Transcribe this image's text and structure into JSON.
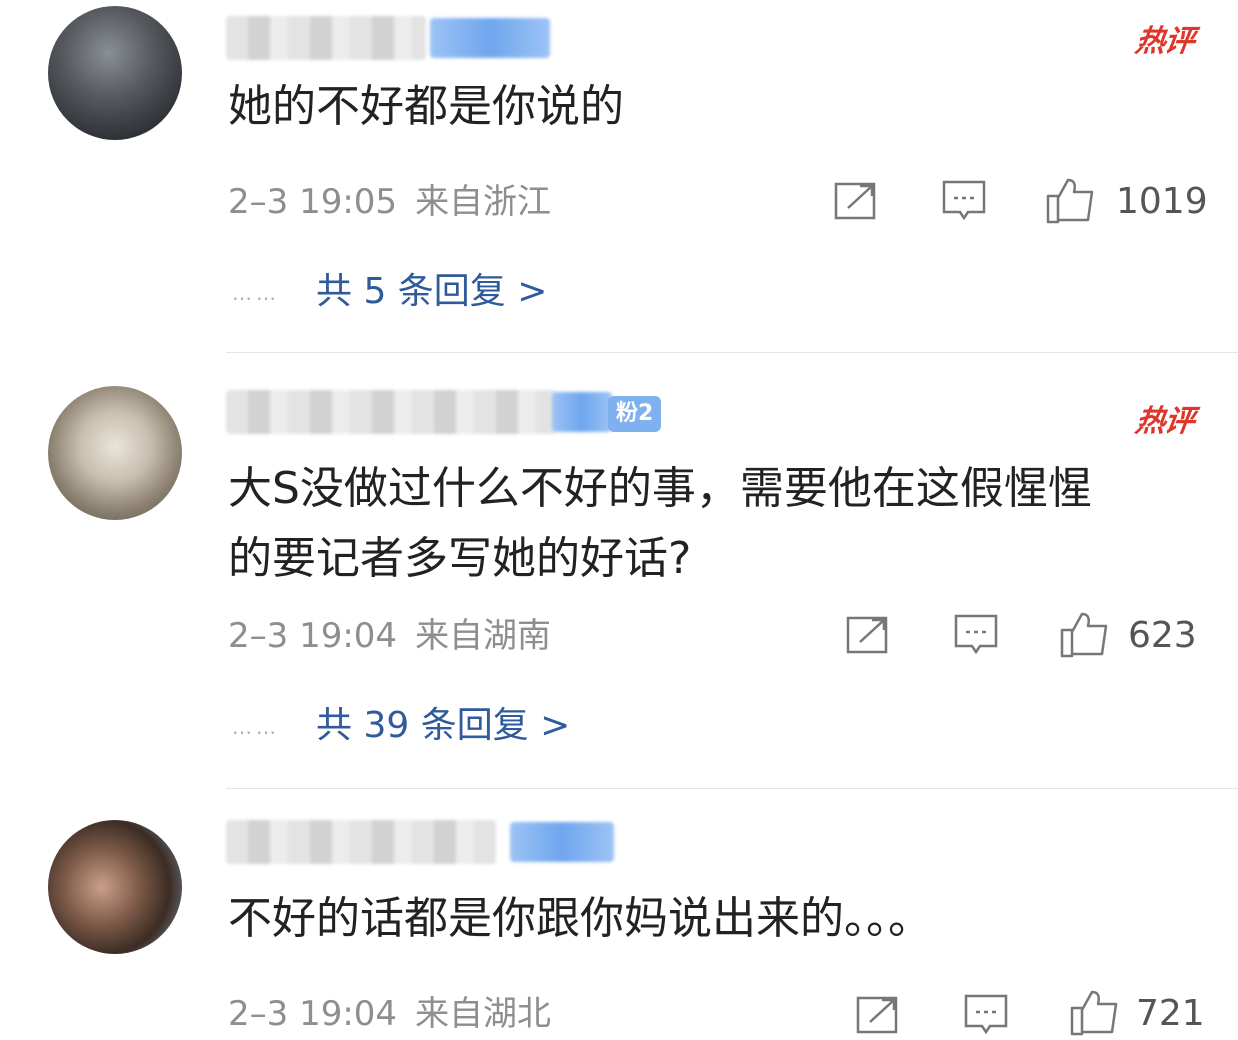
{
  "colors": {
    "accent_link": "#2f5a9c",
    "hot_red": "#e0352b",
    "meta_gray": "#8e8e8e"
  },
  "comments": [
    {
      "hot_label": "热评",
      "text": "她的不好都是你说的",
      "time": "2–3 19:05",
      "location": "来自浙江",
      "likes": "1019",
      "replies": "共 5 条回复 >",
      "dots": "……"
    },
    {
      "hot_label": "热评",
      "fan_badge": "粉2",
      "text": "大S没做过什么不好的事，需要他在这假惺惺\n的要记者多写她的好话?",
      "time": "2–3 19:04",
      "location": "来自湖南",
      "likes": "623",
      "replies": "共 39 条回复 >",
      "dots": "……"
    },
    {
      "text": "不好的话都是你跟你妈说出来的。。。",
      "time": "2–3 19:04",
      "location": "来自湖北",
      "likes": "721"
    }
  ],
  "icons": {
    "share": "share-icon",
    "comment": "comment-icon",
    "like": "thumbs-up-icon"
  }
}
